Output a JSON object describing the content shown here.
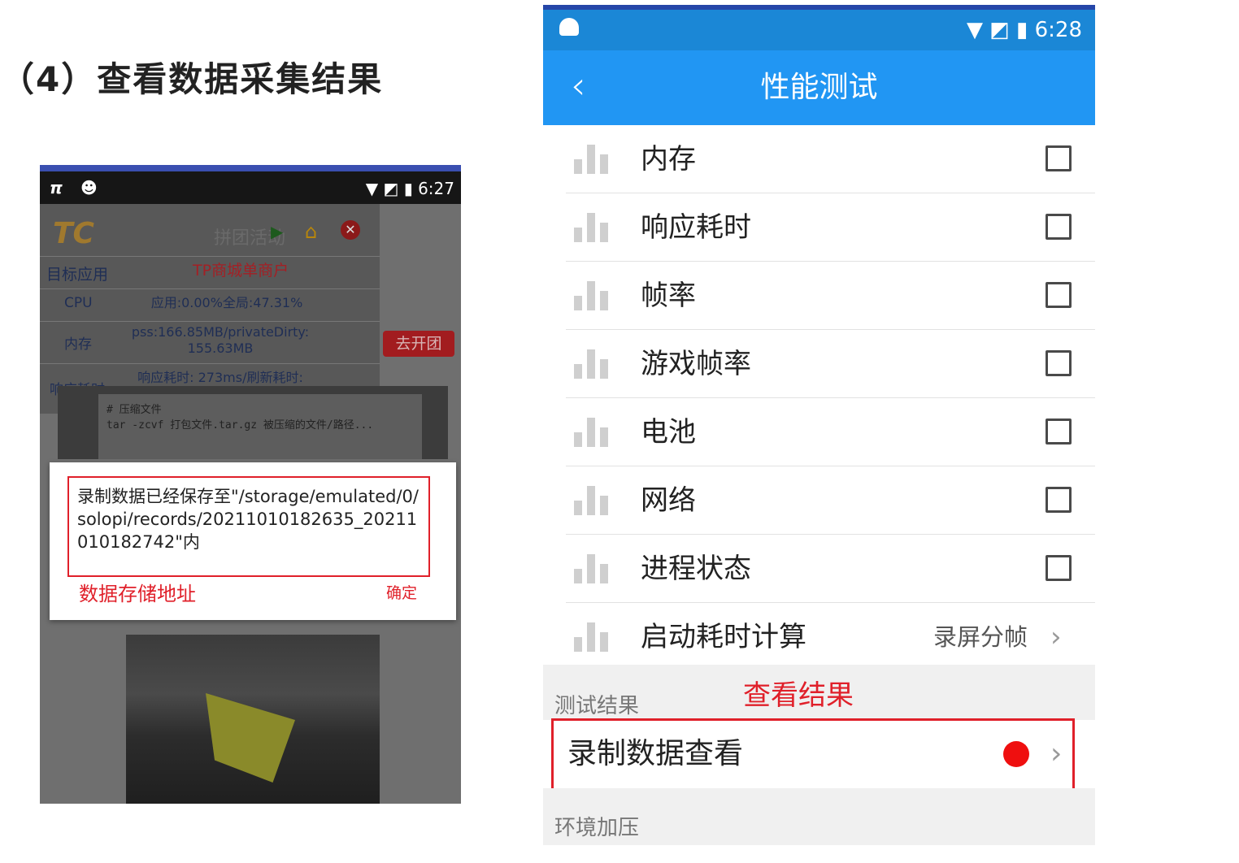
{
  "heading": "（4）查看数据采集结果",
  "left_phone": {
    "status_time": "6:27",
    "app_logo_text": "TC",
    "activity_label": "拼团活动",
    "target_app_label": "目标应用",
    "target_app_value": "TP商城单商户",
    "cpu_label": "CPU",
    "cpu_value": "应用:0.00%全局:47.31%",
    "memory_label": "内存",
    "memory_value": "pss:166.85MB/privateDirty: 155.63MB",
    "response_label": "响应耗时",
    "response_value": "响应耗时: 273ms/刷新耗时: 273ms",
    "go_group_button": "去开团",
    "code_comment": "# 压缩文件",
    "code_line": "tar -zcvf 打包文件.tar.gz 被压缩的文件/路径...",
    "dialog_message": "录制数据已经保存至\"/storage/emulated/0/solopi/records/20211010182635_20211010182742\"内",
    "dialog_annotation": "数据存储地址",
    "dialog_ok": "确定"
  },
  "right_phone": {
    "status_time": "6:28",
    "title": "性能测试",
    "items": [
      {
        "label": "内存"
      },
      {
        "label": "响应耗时"
      },
      {
        "label": "帧率"
      },
      {
        "label": "游戏帧率"
      },
      {
        "label": "电池"
      },
      {
        "label": "网络"
      },
      {
        "label": "进程状态"
      }
    ],
    "startup_label": "启动耗时计算",
    "startup_value": "录屏分帧",
    "test_results_section": "测试结果",
    "view_results_annotation": "查看结果",
    "record_view_label": "录制数据查看",
    "env_section": "环境加压"
  },
  "colors": {
    "accent_blue": "#2196f3",
    "annotation_red": "#e0202a",
    "record_dot": "#ef0f0f"
  }
}
